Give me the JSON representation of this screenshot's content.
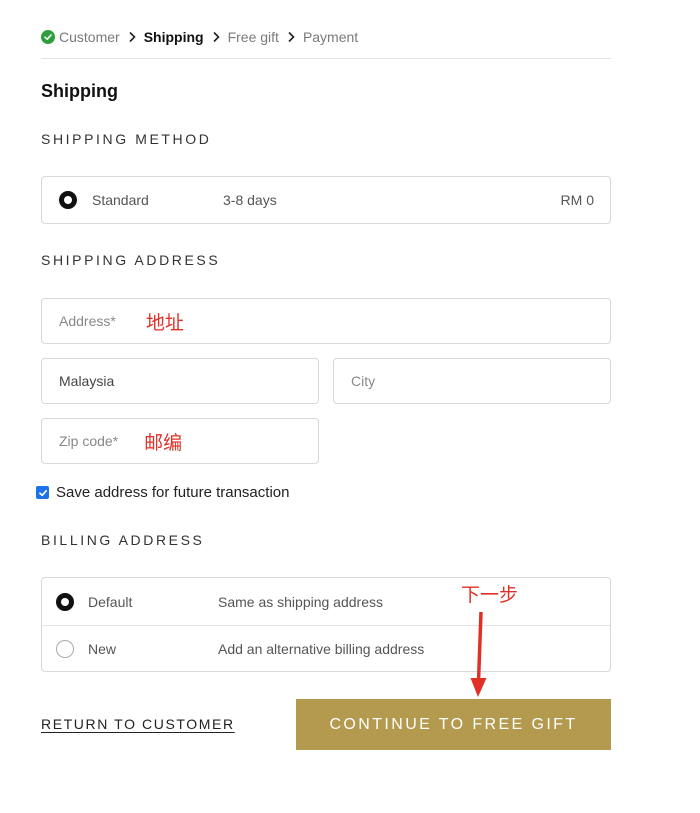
{
  "breadcrumb": {
    "steps": [
      {
        "label": "Customer",
        "state": "complete"
      },
      {
        "label": "Shipping",
        "state": "active"
      },
      {
        "label": "Free gift",
        "state": "upcoming"
      },
      {
        "label": "Payment",
        "state": "upcoming"
      }
    ]
  },
  "page": {
    "title": "Shipping"
  },
  "shipping_method": {
    "heading": "SHIPPING METHOD",
    "option": {
      "name": "Standard",
      "duration": "3-8 days",
      "price": "RM 0",
      "selected": true
    }
  },
  "shipping_address": {
    "heading": "SHIPPING ADDRESS",
    "address_placeholder": "Address*",
    "address_annotation": "地址",
    "country_value": "Malaysia",
    "city_placeholder": "City",
    "zip_placeholder": "Zip code*",
    "zip_annotation": "邮编",
    "save_label": "Save address for future transaction",
    "save_checked": true
  },
  "billing_address": {
    "heading": "BILLING ADDRESS",
    "options": [
      {
        "name": "Default",
        "description": "Same as shipping address",
        "selected": true
      },
      {
        "name": "New",
        "description": "Add an alternative billing address",
        "selected": false
      }
    ]
  },
  "actions": {
    "return_label": "RETURN TO CUSTOMER",
    "continue_label": "CONTINUE TO FREE GIFT",
    "next_annotation": "下一步"
  },
  "colors": {
    "accent": "#b39a4f",
    "check_green": "#2e9e3e",
    "annotation_red": "#e03128",
    "checkbox_blue": "#1a73e8"
  },
  "icons": [
    "check-circle-icon",
    "chevron-right-icon",
    "radio-selected-icon",
    "radio-unselected-icon",
    "checkbox-checked-icon",
    "annotation-arrow-icon"
  ]
}
